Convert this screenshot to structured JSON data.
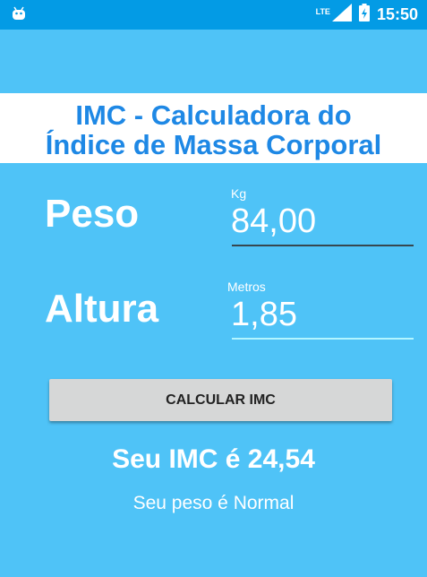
{
  "status_bar": {
    "network_label": "LTE",
    "time": "15:50",
    "icons": [
      "android-icon",
      "signal-icon",
      "battery-charging-icon"
    ]
  },
  "header": {
    "title_line1": "IMC - Calculadora do",
    "title_line2": "Índice de Massa Corporal"
  },
  "form": {
    "peso": {
      "label": "Peso",
      "hint": "Kg",
      "value": "84,00"
    },
    "altura": {
      "label": "Altura",
      "hint": "Metros",
      "value": "1,85"
    }
  },
  "button": {
    "label": "CALCULAR IMC"
  },
  "result": {
    "imc_text": "Seu IMC é 24,54",
    "category_text": "Seu peso é Normal"
  },
  "colors": {
    "background": "#4fc3f7",
    "status_bar": "#039be5",
    "title": "#1e88e5",
    "underline_inactive": "#37474f",
    "underline_active": "#b3f5ff"
  }
}
